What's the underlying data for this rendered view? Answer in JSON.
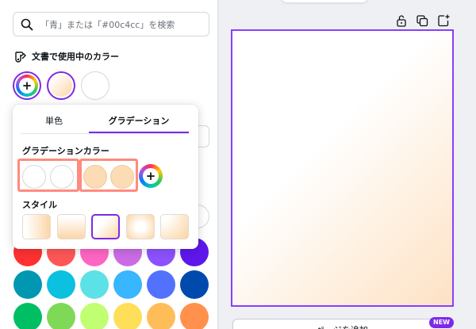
{
  "search": {
    "placeholder": "「青」または「#00c4cc」を検索",
    "value": ""
  },
  "document_colors": {
    "heading": "文書で使用中のカラー",
    "swatches": [
      {
        "type": "add"
      },
      {
        "type": "gradient",
        "from": "#ffffff",
        "to": "#fdd4a5"
      },
      {
        "type": "solid",
        "color": "#ffffff"
      }
    ]
  },
  "popover": {
    "tabs": [
      {
        "label": "単色",
        "active": false
      },
      {
        "label": "グラデーション",
        "active": true
      }
    ],
    "gradient_colors_heading": "グラデーションカラー",
    "gradient_stops": [
      "#ffffff",
      "#ffffff",
      "#fcdcb5",
      "#fcdcb5"
    ],
    "style_heading": "スタイル",
    "styles": [
      {
        "name": "linear-horizontal",
        "selected": false
      },
      {
        "name": "linear-vertical",
        "selected": false
      },
      {
        "name": "linear-diagonal",
        "selected": true
      },
      {
        "name": "radial",
        "selected": false
      },
      {
        "name": "radial-corner",
        "selected": false
      }
    ]
  },
  "default_colors": {
    "row1": [
      "#ff3131",
      "#ff5757",
      "#ff66c4",
      "#cb6ce6",
      "#8c52ff",
      "#5e17eb"
    ],
    "row2": [
      "#0097b2",
      "#0cc0df",
      "#5ce1e6",
      "#38b6ff",
      "#5271ff",
      "#004aad"
    ],
    "row3": [
      "#00bf63",
      "#7ed957",
      "#c1ff72",
      "#ffde59",
      "#ffbd59",
      "#ff914d"
    ]
  },
  "canvas": {
    "gradient_from": "#ffffff",
    "gradient_to": "#fde2c4",
    "selection_color": "#8b3dff",
    "add_page_label": "ページを追加",
    "new_badge": "NEW"
  },
  "colors": {
    "accent": "#7d2ae8",
    "highlight_box": "#ff8b7e"
  }
}
